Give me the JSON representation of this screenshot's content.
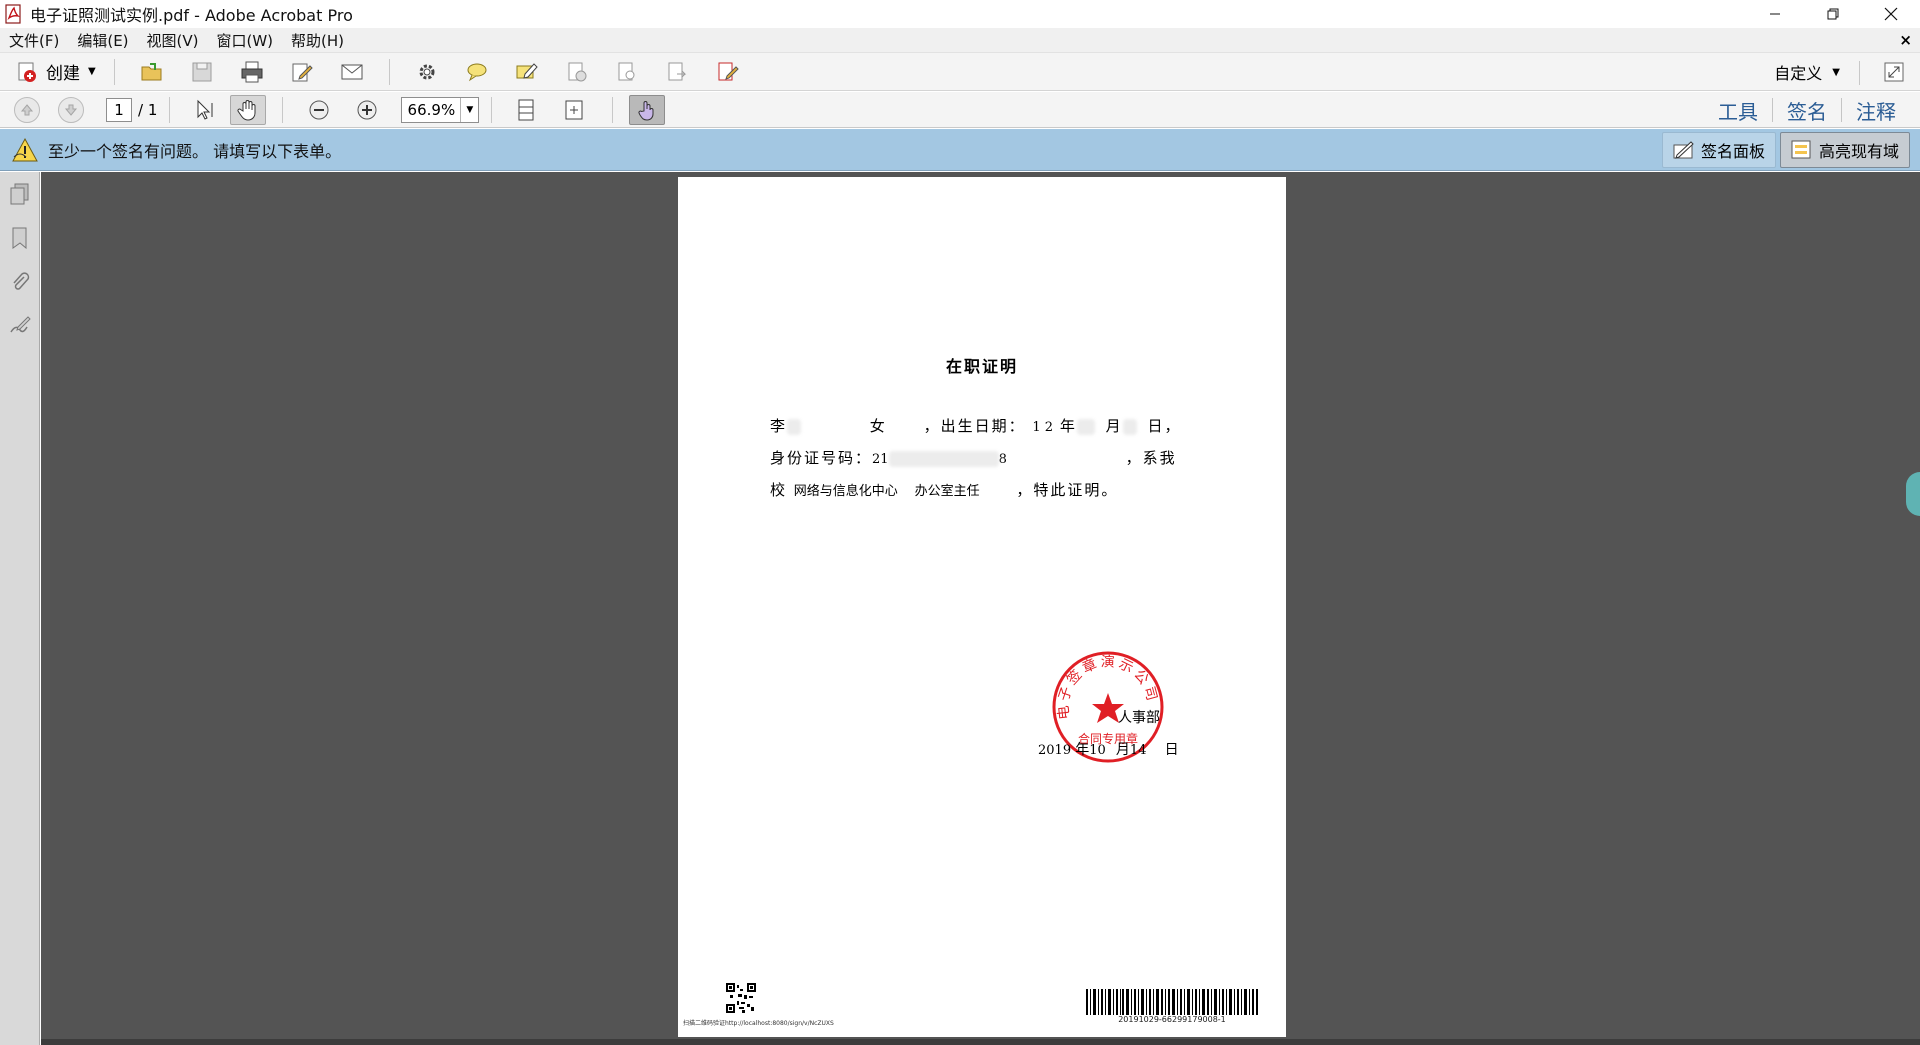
{
  "window": {
    "title": "电子证照测试实例.pdf - Adobe Acrobat Pro"
  },
  "menu": {
    "items": [
      "文件(F)",
      "编辑(E)",
      "视图(V)",
      "窗口(W)",
      "帮助(H)"
    ]
  },
  "toolbar": {
    "create_label": "创建",
    "customize_label": "自定义"
  },
  "nav": {
    "page_current": "1",
    "page_total": "/ 1",
    "zoom": "66.9%",
    "right_links": [
      "工具",
      "签名",
      "注释"
    ]
  },
  "notification": {
    "message": "至少一个签名有问题。 请填写以下表单。",
    "signature_panel_label": "签名面板",
    "highlight_fields_label": "高亮现有域"
  },
  "document": {
    "title": "在职证明",
    "line1": {
      "name_prefix": "李",
      "gender": "女",
      "birth_label": "，出生日期：",
      "year_part": "1  2",
      "year_label": "年",
      "month_label": "月",
      "day_label": "日，"
    },
    "line2": {
      "id_label": "身份证号码：",
      "id_prefix": "21",
      "id_suffix": "8",
      "suffix": "，系我"
    },
    "line3": {
      "prefix": "校",
      "department": "网络与信息化中心",
      "position": "办公室主任",
      "suffix": "，特此证明。"
    },
    "seal_text_top": "电子签章演示公司",
    "seal_text_bottom": "合同专用章",
    "dept_text": "人事部",
    "date": {
      "year": "2019",
      "year_label": "年",
      "month": "10",
      "month_label": "月",
      "day": "14",
      "day_label": "日"
    },
    "qr_caption": "扫描二维码验证http://localhost:8080/sign/v/NcZUXS",
    "barcode_number": "20191029-66299179008-1"
  },
  "colors": {
    "notification_bg": "#a3c7e2",
    "doc_bg": "#545454",
    "link_blue": "#2b5d95",
    "seal_red": "#e01f25"
  }
}
